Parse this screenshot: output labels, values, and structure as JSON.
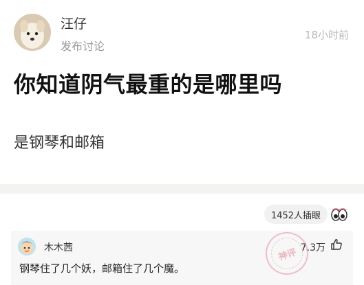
{
  "post": {
    "username": "汪仔",
    "action": "发布讨论",
    "time": "18小时前",
    "title": "你知道阴气最重的是哪里吗",
    "content": "是钢琴和邮箱"
  },
  "reactions": {
    "count_label": "1452人插眼",
    "icon": "eyes-icon"
  },
  "comment": {
    "username": "木木茜",
    "likes": "7.3万",
    "text": "钢琴住了几个妖，邮箱住了几个魔。",
    "stamp_text": "神评",
    "like_icon": "thumb-up-icon"
  },
  "colors": {
    "background": "#ffffff",
    "gap": "#f3f3f1",
    "comment_bg": "#f7f7f7",
    "muted_text": "#9a9a9a",
    "stamp": "#e2788c"
  }
}
